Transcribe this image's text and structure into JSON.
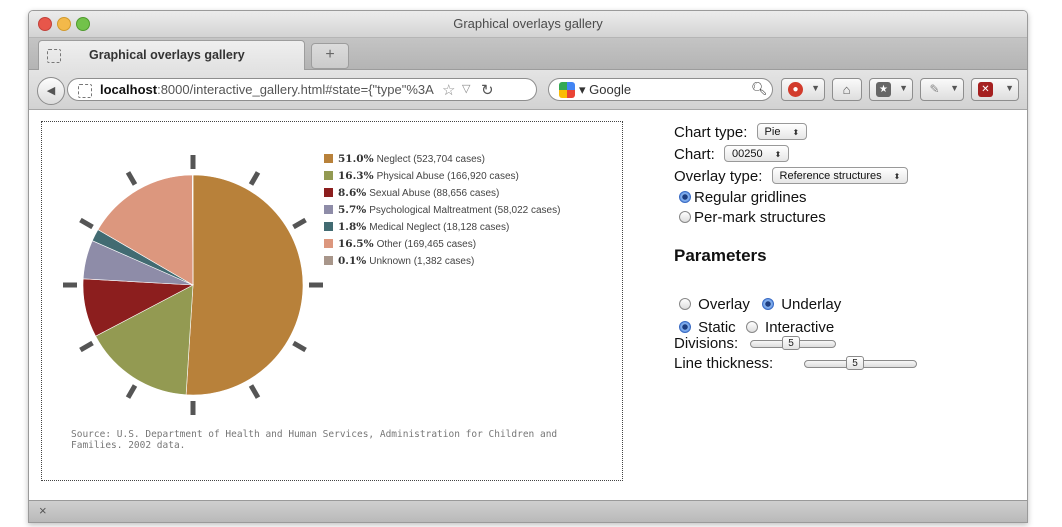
{
  "window": {
    "title": "Graphical overlays gallery"
  },
  "tabs": [
    {
      "label": "Graphical overlays gallery"
    }
  ],
  "new_tab_label": "+",
  "address_bar": {
    "host": "localhost",
    "rest": ":8000/interactive_gallery.html#state={\"type\"%3A"
  },
  "search": {
    "engine": "Google"
  },
  "colors": {
    "accent": "#5a8ee0",
    "window_bg": "#e9e9e9"
  },
  "chart_data": {
    "type": "pie",
    "source": "Source: U.S. Department of Health and Human Services, Administration for Children and Families. 2002 data.",
    "slices": [
      {
        "pct_label": "51.0%",
        "text": "Neglect (523,704 cases)",
        "value": 51.0,
        "color": "#b8813a"
      },
      {
        "pct_label": "16.3%",
        "text": "Physical Abuse (166,920 cases)",
        "value": 16.3,
        "color": "#939a52"
      },
      {
        "pct_label": "8.6%",
        "text": "Sexual Abuse (88,656 cases)",
        "value": 8.6,
        "color": "#8c1e1e"
      },
      {
        "pct_label": "5.7%",
        "text": "Psychological Maltreatment (58,022 cases)",
        "value": 5.7,
        "color": "#8e8ca8"
      },
      {
        "pct_label": "1.8%",
        "text": "Medical Neglect (18,128 cases)",
        "value": 1.8,
        "color": "#426b72"
      },
      {
        "pct_label": "16.5%",
        "text": "Other (169,465 cases)",
        "value": 16.5,
        "color": "#dc977e"
      },
      {
        "pct_label": "0.1%",
        "text": "Unknown (1,382 cases)",
        "value": 0.1,
        "color": "#a8968a"
      }
    ],
    "gridlines": "radial"
  },
  "panel": {
    "chart_type_label": "Chart type:",
    "chart_type_value": "Pie",
    "chart_label": "Chart:",
    "chart_value": "00250",
    "overlay_type_label": "Overlay type:",
    "overlay_type_value": "Reference structures",
    "options": [
      {
        "label": "Regular gridlines",
        "selected": true
      },
      {
        "label": "Per-mark structures",
        "selected": false
      }
    ],
    "parameters_heading": "Parameters",
    "layer_overlay": "Overlay",
    "layer_underlay": "Underlay",
    "layer_selected": "Underlay",
    "mode_static": "Static",
    "mode_interactive": "Interactive",
    "mode_selected": "Static",
    "divisions_label": "Divisions:",
    "divisions_value": "5",
    "thickness_label": "Line thickness:",
    "thickness_value": "5"
  },
  "status": {
    "close_label": "×"
  }
}
